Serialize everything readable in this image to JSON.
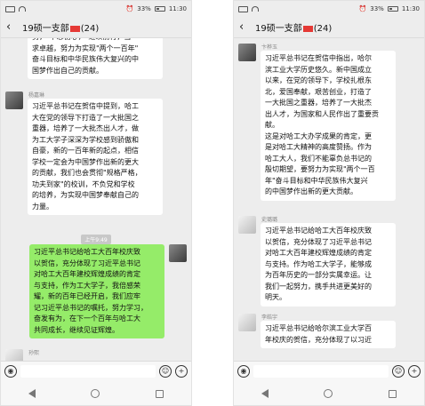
{
  "left_phone": {
    "status_left": "45 46 ▯ ≡ ⊙",
    "battery_pct": "33%",
    "clock": "11:30",
    "chat_title": "19硕一支部",
    "member_count": "(24)",
    "partial_message": "努，\"不忘初心，\"继续前行，当\n求卓越，努力为实现\"两个一百年\"\n奋斗目标和中华民族伟大复兴的中\n国梦作出自己的贡献。",
    "sender_1": "杨嘉琳",
    "message_1": "习近平总书记在贺信中提到，哈工\n大在党的领导下打造了一大批国之\n重器，培养了一大批杰出人才，做\n为工大学子深深为学校感到骄傲和\n自豪，新的一百年新的起点，相信\n学校一定会为中国梦作出新的更大\n的贡献，我们也会贯彻\"规格严格，\n功夫到家\"的校训，不负党和学校\n的培养，为实现中国梦奉献自己的\n力量。",
    "time_divider": "上午9:49",
    "message_2": "习近平总书记给哈工大百年校庆致\n以贺信，充分体现了习近平总书记\n对哈工大百年建校辉煌成绩的肯定\n与支持，作为工大学子，我倍感荣\n耀，新的百年已经开启，我们应牢\n记习近平总书记的嘱托，努力学习，\n奋发有为，在下一个百年与哈工大\n共同成长，继续见证辉煌。",
    "sender_last": "孙熙"
  },
  "right_phone": {
    "status_left": "45 46 ▯ ≡ ⊙",
    "battery_pct": "33%",
    "clock": "11:30",
    "chat_title": "19硕一支部",
    "member_count": "(24)",
    "sender_1": "卞桦玉",
    "message_1": "习近平总书记在贺信中指出，哈尔\n滨工业大学历史悠久。新中国成立\n以来，在党的领导下，学校扎根东\n北，爱国奉献，艰苦创业，打造了\n一大批国之重器，培养了一大批杰\n出人才，为国家和人民作出了重要贡\n献。\n这是对哈工大办学成果的肯定，更\n是对哈工大精神的高度赞扬。作为\n哈工大人，我们不能辜负总书记的\n殷切期望，要努力为实现\"两个一百\n年\"奋斗目标和中华民族伟大复兴\n的中国梦作出新的更大贡献。",
    "sender_2": "史璐璐",
    "message_2": "习近平总书记给哈工大百年校庆致\n以贺信，充分体现了习近平总书记\n对哈工大百年建校辉煌成绩的肯定\n与支持。作为哈工大学子，能够成\n为百年历史的一部分实属幸运。让\n我们一起努力，携手共进更美好的\n明天。",
    "sender_3": "李皓宇",
    "message_3": "习近平总书记给哈尔滨工业大学百\n年校庆的贺信，充分体现了以习近"
  },
  "input_bar": {
    "voice_icon": "◉",
    "emoji_icon": "☺",
    "plus_icon": "+"
  },
  "colors": {
    "my_bubble": "#95ec69",
    "other_bubble": "#ffffff",
    "chat_bg": "#ededed"
  }
}
